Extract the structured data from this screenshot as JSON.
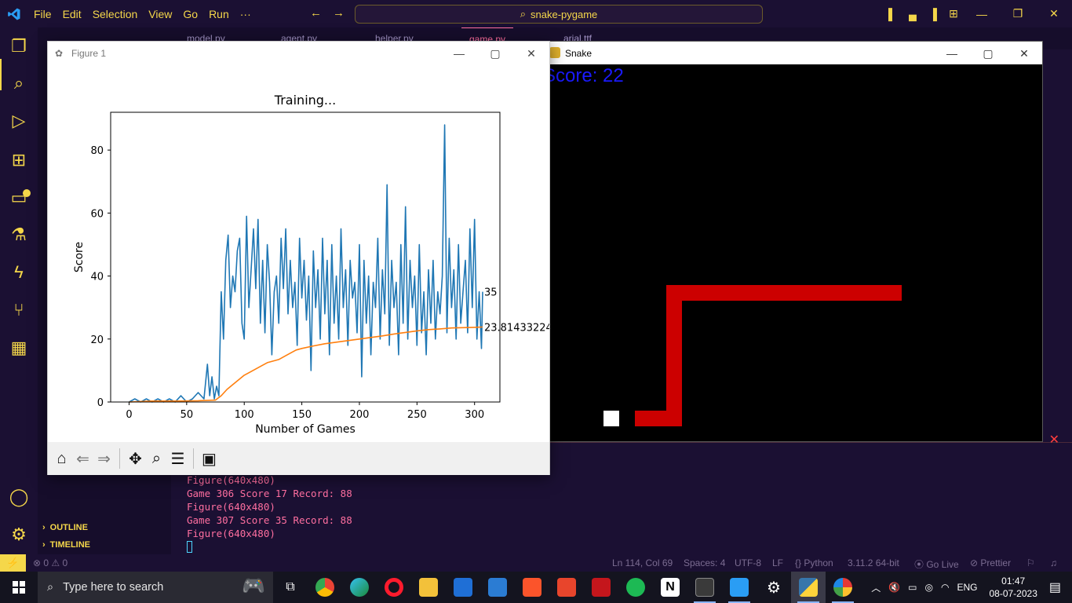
{
  "titlebar": {
    "menu": [
      "File",
      "Edit",
      "Selection",
      "View",
      "Go",
      "Run",
      "···"
    ],
    "command_center": "snake-pygame"
  },
  "tabs": [
    "model.py",
    "agent.py",
    "helper.py",
    "game.py",
    "arial.ttf"
  ],
  "sidebar": {
    "outline": "OUTLINE",
    "timeline": "TIMELINE"
  },
  "terminal": {
    "lines": [
      "Figure(640x480)",
      "Game 306 Score 17 Record: 88",
      "Figure(640x480)",
      "Game 307 Score 35 Record: 88",
      "Figure(640x480)"
    ]
  },
  "statusbar": {
    "problems": "⊗ 0 ⚠ 0",
    "position": "Ln 114, Col 69",
    "spaces": "Spaces: 4",
    "encoding": "UTF-8",
    "eol": "LF",
    "language": "{} Python",
    "interpreter": "3.11.2 64-bit",
    "golive": "⦿ Go Live",
    "prettier": "⊘ Prettier"
  },
  "figure": {
    "window_title": "Figure 1",
    "toolbar": [
      "home-icon",
      "back-icon",
      "forward-icon",
      "pan-icon",
      "zoom-icon",
      "configure-icon",
      "save-icon"
    ]
  },
  "chart_data": {
    "type": "line",
    "title": "Training...",
    "xlabel": "Number of Games",
    "ylabel": "Score",
    "xlim": [
      -16,
      322
    ],
    "ylim": [
      0,
      92
    ],
    "xticks": [
      0,
      50,
      100,
      150,
      200,
      250,
      300
    ],
    "yticks": [
      0,
      20,
      40,
      60,
      80
    ],
    "grid": false,
    "series": [
      {
        "color": "#1f77b4",
        "points": [
          [
            0,
            0
          ],
          [
            5,
            1
          ],
          [
            10,
            0
          ],
          [
            15,
            1
          ],
          [
            20,
            0
          ],
          [
            25,
            1
          ],
          [
            30,
            0
          ],
          [
            35,
            1
          ],
          [
            40,
            0
          ],
          [
            45,
            2
          ],
          [
            50,
            0
          ],
          [
            55,
            1
          ],
          [
            60,
            3
          ],
          [
            65,
            1
          ],
          [
            68,
            12
          ],
          [
            70,
            2
          ],
          [
            72,
            8
          ],
          [
            74,
            1
          ],
          [
            76,
            5
          ],
          [
            78,
            2
          ],
          [
            80,
            35
          ],
          [
            82,
            20
          ],
          [
            84,
            45
          ],
          [
            86,
            53
          ],
          [
            88,
            30
          ],
          [
            90,
            40
          ],
          [
            92,
            35
          ],
          [
            94,
            48
          ],
          [
            96,
            52
          ],
          [
            98,
            25
          ],
          [
            100,
            20
          ],
          [
            102,
            59
          ],
          [
            104,
            30
          ],
          [
            106,
            42
          ],
          [
            108,
            55
          ],
          [
            110,
            36
          ],
          [
            112,
            58
          ],
          [
            114,
            25
          ],
          [
            116,
            45
          ],
          [
            118,
            22
          ],
          [
            120,
            50
          ],
          [
            122,
            38
          ],
          [
            124,
            15
          ],
          [
            126,
            35
          ],
          [
            128,
            40
          ],
          [
            130,
            25
          ],
          [
            132,
            52
          ],
          [
            134,
            36
          ],
          [
            136,
            55
          ],
          [
            138,
            28
          ],
          [
            140,
            45
          ],
          [
            142,
            30
          ],
          [
            144,
            38
          ],
          [
            146,
            18
          ],
          [
            148,
            52
          ],
          [
            150,
            33
          ],
          [
            152,
            45
          ],
          [
            154,
            26
          ],
          [
            156,
            40
          ],
          [
            158,
            10
          ],
          [
            160,
            48
          ],
          [
            162,
            30
          ],
          [
            164,
            42
          ],
          [
            166,
            20
          ],
          [
            168,
            52
          ],
          [
            170,
            28
          ],
          [
            172,
            45
          ],
          [
            174,
            15
          ],
          [
            176,
            50
          ],
          [
            178,
            25
          ],
          [
            180,
            40
          ],
          [
            182,
            20
          ],
          [
            184,
            55
          ],
          [
            186,
            30
          ],
          [
            188,
            42
          ],
          [
            190,
            18
          ],
          [
            192,
            45
          ],
          [
            194,
            33
          ],
          [
            196,
            38
          ],
          [
            198,
            22
          ],
          [
            200,
            50
          ],
          [
            202,
            8
          ],
          [
            204,
            45
          ],
          [
            206,
            25
          ],
          [
            208,
            40
          ],
          [
            210,
            15
          ],
          [
            212,
            38
          ],
          [
            214,
            30
          ],
          [
            216,
            52
          ],
          [
            218,
            20
          ],
          [
            220,
            42
          ],
          [
            222,
            28
          ],
          [
            224,
            69
          ],
          [
            226,
            18
          ],
          [
            228,
            45
          ],
          [
            230,
            30
          ],
          [
            232,
            38
          ],
          [
            234,
            15
          ],
          [
            236,
            50
          ],
          [
            238,
            25
          ],
          [
            240,
            62
          ],
          [
            242,
            20
          ],
          [
            244,
            45
          ],
          [
            246,
            30
          ],
          [
            248,
            40
          ],
          [
            250,
            18
          ],
          [
            252,
            50
          ],
          [
            254,
            22
          ],
          [
            256,
            35
          ],
          [
            258,
            15
          ],
          [
            260,
            42
          ],
          [
            262,
            25
          ],
          [
            264,
            45
          ],
          [
            266,
            20
          ],
          [
            268,
            35
          ],
          [
            270,
            28
          ],
          [
            272,
            40
          ],
          [
            274,
            88
          ],
          [
            276,
            22
          ],
          [
            278,
            52
          ],
          [
            280,
            30
          ],
          [
            282,
            42
          ],
          [
            284,
            20
          ],
          [
            286,
            50
          ],
          [
            288,
            25
          ],
          [
            290,
            35
          ],
          [
            292,
            45
          ],
          [
            294,
            22
          ],
          [
            296,
            55
          ],
          [
            298,
            30
          ],
          [
            300,
            58
          ],
          [
            302,
            20
          ],
          [
            304,
            35
          ],
          [
            306,
            17
          ],
          [
            307,
            35
          ]
        ],
        "end_label": "35"
      },
      {
        "color": "#ff7f0e",
        "points": [
          [
            0,
            0
          ],
          [
            20,
            0.3
          ],
          [
            40,
            0.3
          ],
          [
            60,
            0.4
          ],
          [
            75,
            0.6
          ],
          [
            80,
            2
          ],
          [
            85,
            4
          ],
          [
            90,
            5.5
          ],
          [
            95,
            7
          ],
          [
            100,
            8.5
          ],
          [
            105,
            9.5
          ],
          [
            110,
            10.5
          ],
          [
            115,
            11.5
          ],
          [
            120,
            12.5
          ],
          [
            125,
            13
          ],
          [
            130,
            13.5
          ],
          [
            135,
            14.5
          ],
          [
            140,
            15.5
          ],
          [
            145,
            16.5
          ],
          [
            150,
            17
          ],
          [
            160,
            17.8
          ],
          [
            170,
            18.5
          ],
          [
            180,
            19
          ],
          [
            190,
            19.5
          ],
          [
            200,
            20
          ],
          [
            210,
            20.5
          ],
          [
            220,
            21
          ],
          [
            230,
            21.6
          ],
          [
            240,
            22.1
          ],
          [
            250,
            22.6
          ],
          [
            260,
            23
          ],
          [
            270,
            23.2
          ],
          [
            280,
            23.5
          ],
          [
            290,
            23.6
          ],
          [
            300,
            23.7
          ],
          [
            307,
            23.81
          ]
        ],
        "end_label": "23.81433224"
      }
    ]
  },
  "snake_window": {
    "title": "Snake",
    "score_text": "Score: 22"
  },
  "taskbar": {
    "search_placeholder": "Type here to search",
    "language": "ENG",
    "time": "01:47",
    "date": "08-07-2023"
  }
}
